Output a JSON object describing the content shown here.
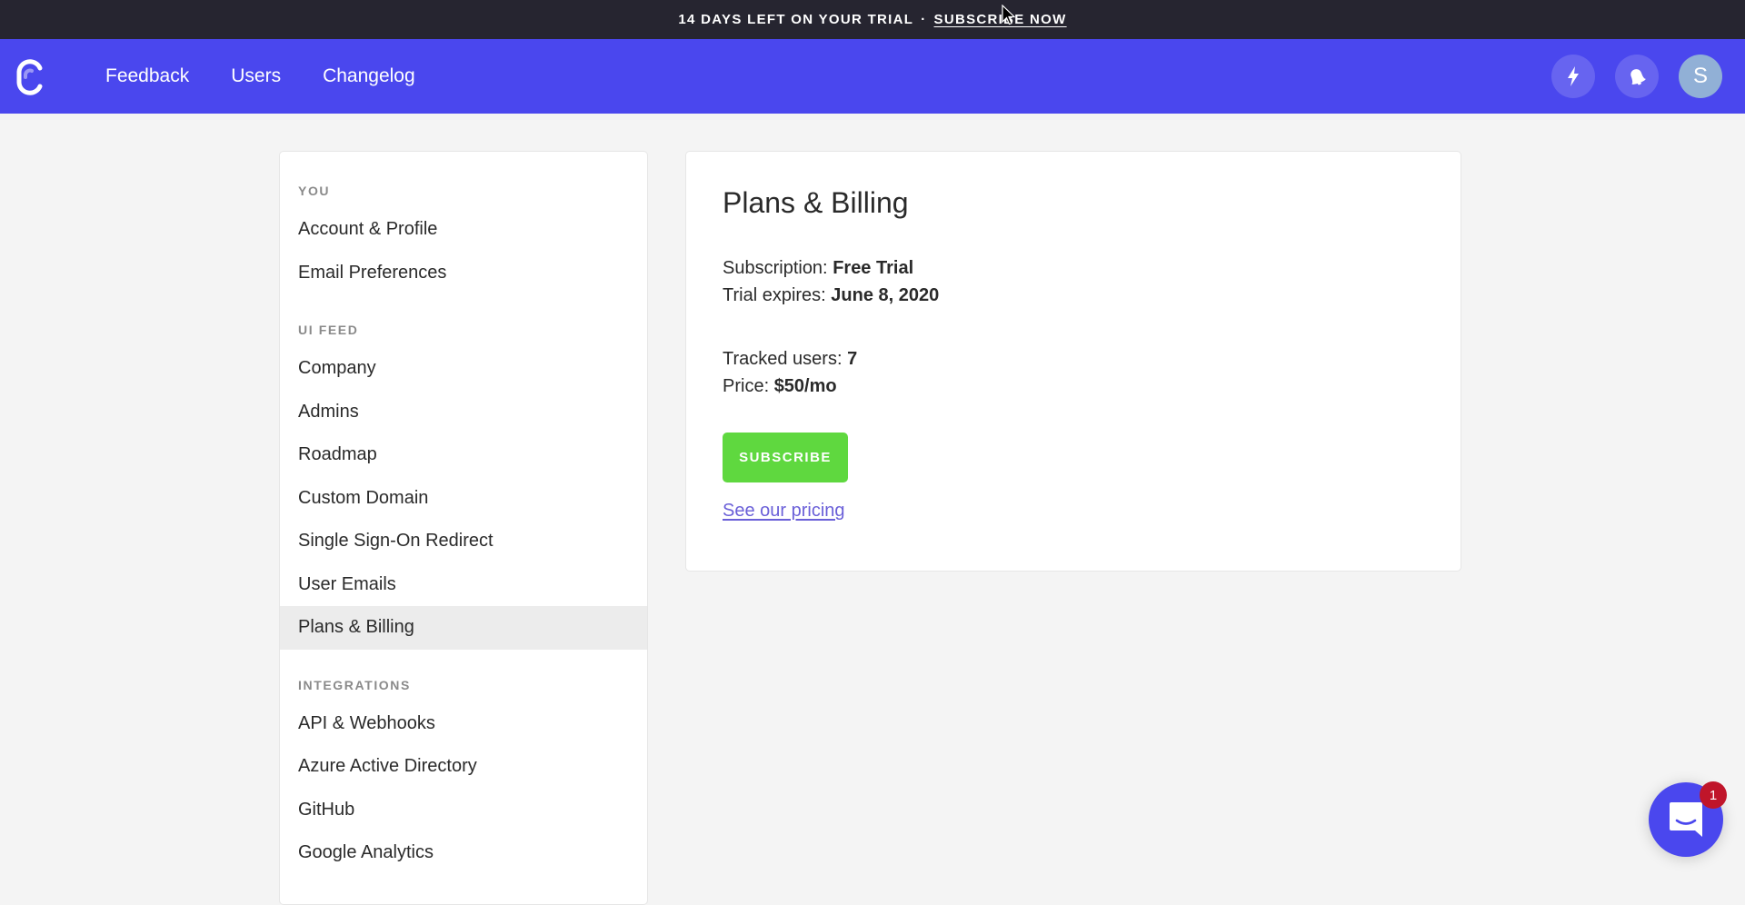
{
  "banner": {
    "message": "14 DAYS LEFT ON YOUR TRIAL",
    "separator": "·",
    "cta": "SUBSCRIBE NOW"
  },
  "nav": {
    "logo": "canny-logo-icon",
    "links": [
      {
        "label": "Feedback"
      },
      {
        "label": "Users"
      },
      {
        "label": "Changelog"
      }
    ],
    "actions": [
      {
        "icon": "lightning-icon"
      },
      {
        "icon": "bell-icon"
      }
    ],
    "avatar_initial": "S",
    "accent_color": "#4a47ee"
  },
  "sidebar": {
    "sections": [
      {
        "label": "YOU",
        "items": [
          {
            "label": "Account & Profile",
            "active": false
          },
          {
            "label": "Email Preferences",
            "active": false
          }
        ]
      },
      {
        "label": "UI FEED",
        "items": [
          {
            "label": "Company",
            "active": false
          },
          {
            "label": "Admins",
            "active": false
          },
          {
            "label": "Roadmap",
            "active": false
          },
          {
            "label": "Custom Domain",
            "active": false
          },
          {
            "label": "Single Sign-On Redirect",
            "active": false
          },
          {
            "label": "User Emails",
            "active": false
          },
          {
            "label": "Plans & Billing",
            "active": true
          }
        ]
      },
      {
        "label": "INTEGRATIONS",
        "items": [
          {
            "label": "API & Webhooks",
            "active": false
          },
          {
            "label": "Azure Active Directory",
            "active": false
          },
          {
            "label": "GitHub",
            "active": false
          },
          {
            "label": "Google Analytics",
            "active": false
          }
        ]
      }
    ]
  },
  "main": {
    "title": "Plans & Billing",
    "subscription_label": "Subscription:",
    "subscription_value": "Free Trial",
    "trial_expires_label": "Trial expires:",
    "trial_expires_value": "June 8, 2020",
    "tracked_users_label": "Tracked users:",
    "tracked_users_value": "7",
    "price_label": "Price:",
    "price_value": "$50/mo",
    "subscribe_button": "SUBSCRIBE",
    "pricing_link": "See our pricing",
    "button_color": "#5fd83f"
  },
  "chat": {
    "icon": "chat-bubble-icon",
    "badge_count": "1"
  }
}
